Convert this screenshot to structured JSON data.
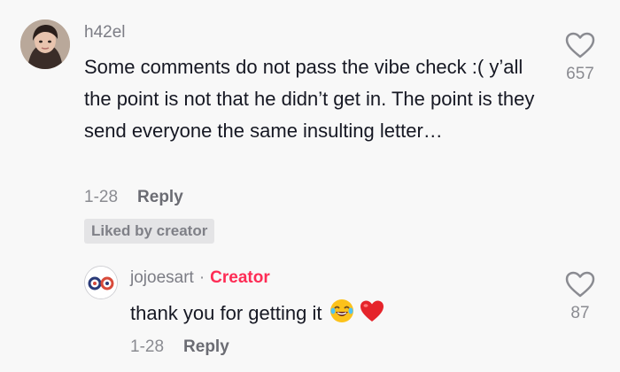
{
  "comment": {
    "username": "h42el",
    "text": "Some comments do not pass the vibe check :( y’all the point is not that he didn’t get in. The point is they send everyone the same insulting letter…",
    "date": "1-28",
    "reply_label": "Reply",
    "liked_badge": "Liked by creator",
    "like_count": "657",
    "avatar_icon": "user-avatar-photo"
  },
  "reply": {
    "username": "jojoesart",
    "separator": "·",
    "creator_label": "Creator",
    "text": "thank you for getting it",
    "emojis": [
      "joy-emoji",
      "red-heart-emoji"
    ],
    "date": "1-28",
    "reply_label": "Reply",
    "like_count": "87",
    "avatar_icon": "creator-logo-avatar"
  },
  "colors": {
    "background": "#f8f8f8",
    "text_primary": "#161823",
    "text_secondary": "#8a8b91",
    "creator_accent": "#fe2c55",
    "badge_bg": "#e4e4e6"
  }
}
